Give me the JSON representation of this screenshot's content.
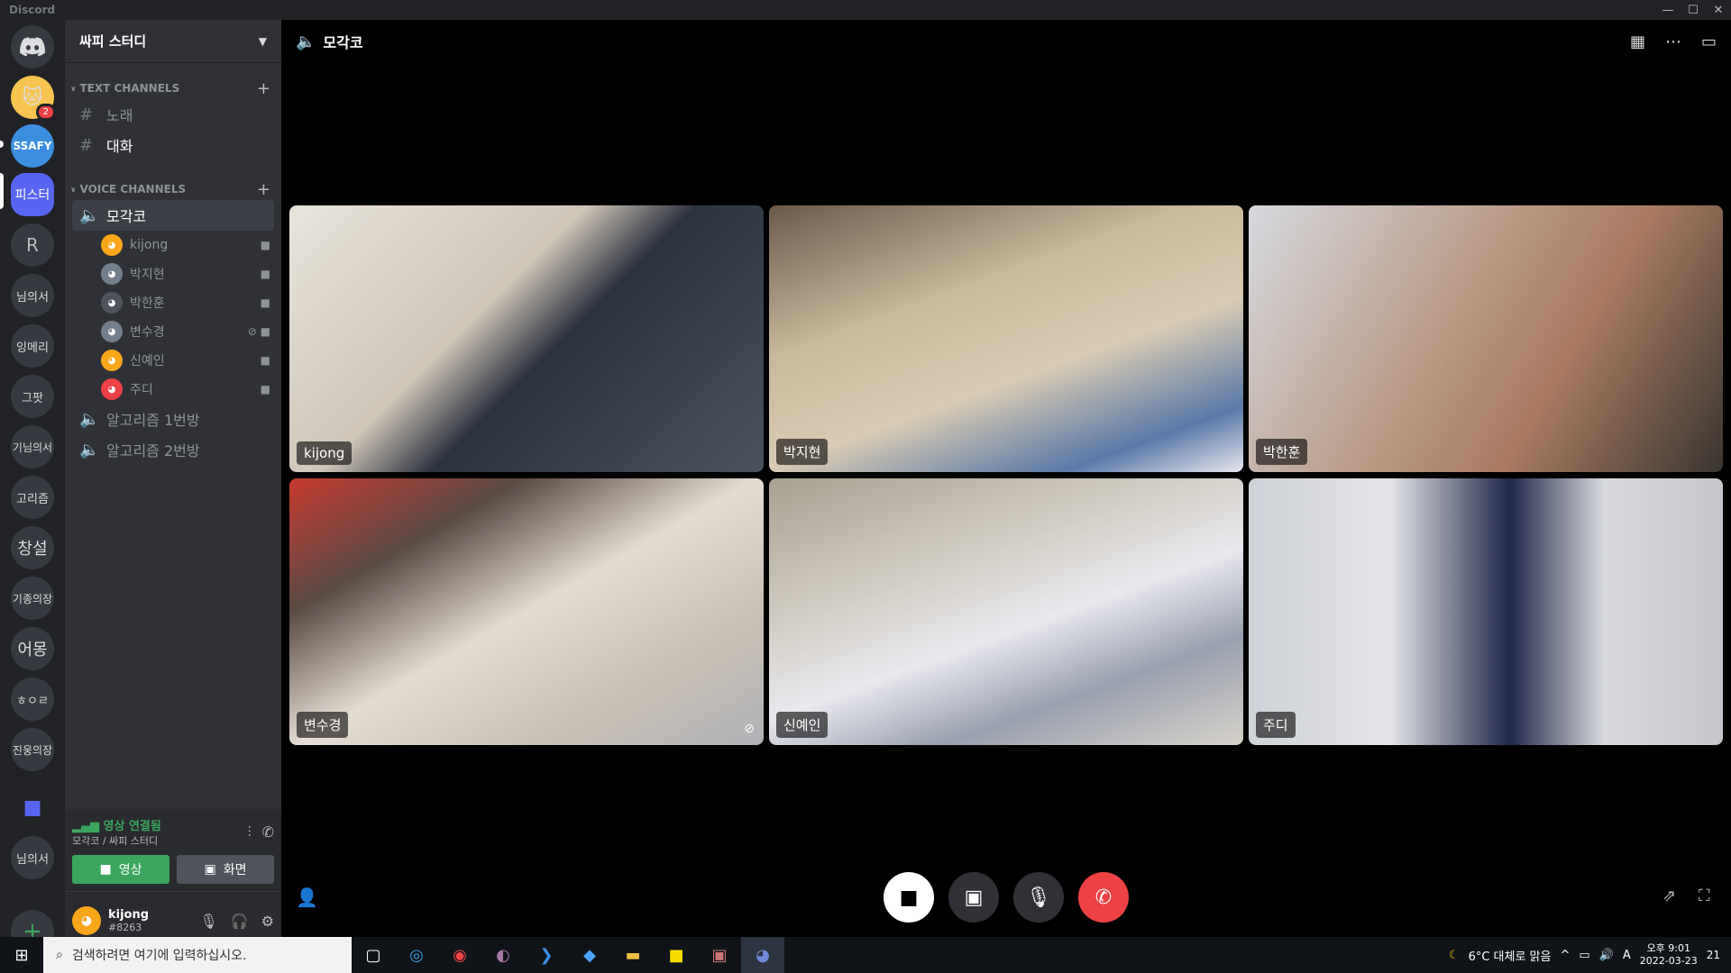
{
  "window": {
    "title": "Discord"
  },
  "guilds": {
    "items": [
      {
        "label": "",
        "icon": "discord-icon"
      },
      {
        "label": "",
        "badge": "2"
      },
      {
        "label": "SSAFY"
      },
      {
        "label": "피스터"
      },
      {
        "label": "R"
      },
      {
        "label": "님의서"
      },
      {
        "label": "잉메리"
      },
      {
        "label": "그팟"
      },
      {
        "label": "기님의서"
      },
      {
        "label": "고리즘"
      },
      {
        "label": "창설"
      },
      {
        "label": "기종의장"
      },
      {
        "label": "어몽"
      },
      {
        "label": "ㅎㅇㄹ"
      },
      {
        "label": "진웅의장"
      },
      {
        "label": "",
        "icon": "folder-icon"
      },
      {
        "label": "님의서"
      }
    ],
    "add_label": "+"
  },
  "server": {
    "name": "싸피 스터디",
    "text_category": "TEXT CHANNELS",
    "text_channels": [
      "노래",
      "대화"
    ],
    "voice_category": "VOICE CHANNELS",
    "voice_channels": [
      "모각코",
      "알고리즘 1번방",
      "알고리즘 2번방"
    ],
    "voice_users": [
      "kijong",
      "박지현",
      "박한훈",
      "변수경",
      "신예인",
      "주디"
    ]
  },
  "voice_panel": {
    "status": "영상 연결됨",
    "location": "모각코 / 싸피 스터디",
    "video_label": "영상",
    "screen_label": "화면"
  },
  "user_panel": {
    "username": "kijong",
    "tag": "#8263"
  },
  "call": {
    "channel_name": "모각코",
    "participants": [
      "kijong",
      "박지현",
      "박한훈",
      "변수경",
      "신예인",
      "주디"
    ]
  },
  "taskbar": {
    "search_placeholder": "검색하려면 여기에 입력하십시오.",
    "weather": "6°C  대체로 맑음",
    "time": "오후 9:01",
    "date": "2022-03-23",
    "notification_count": "21"
  },
  "colors": {
    "accent": "#5865f2",
    "green": "#3ba55d",
    "red": "#ed4245"
  }
}
